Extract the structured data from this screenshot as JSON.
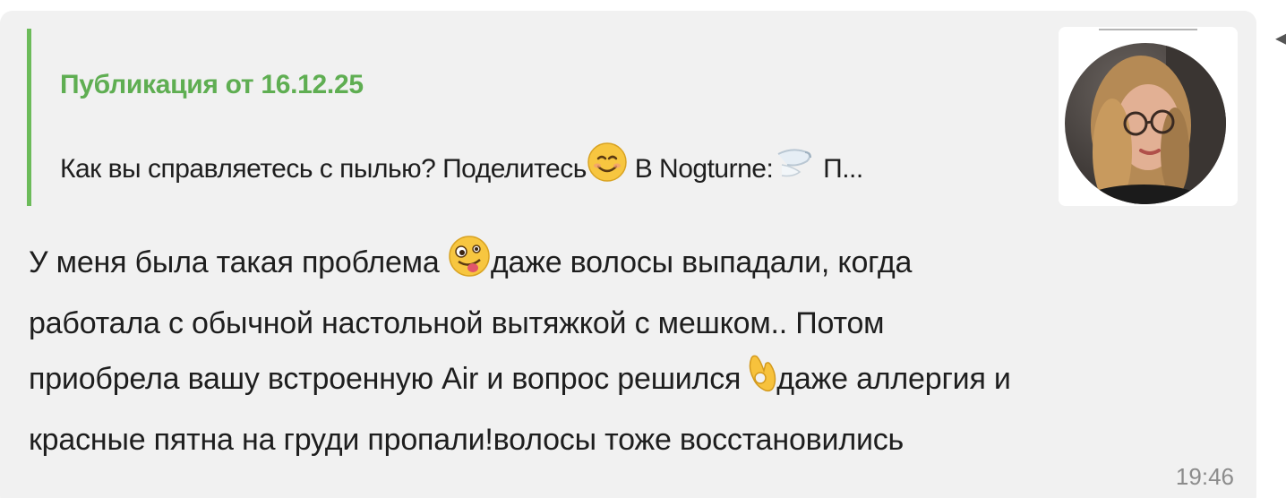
{
  "reply": {
    "title": "Публикация от 16.12.25",
    "snippet_part1": "Как вы справляетесь с пылью? Поделитесь",
    "snippet_part2": " В Nogturne:",
    "snippet_part3": " П..."
  },
  "message": {
    "line1_a": "У меня была такая проблема ",
    "line1_b": "даже волосы выпадали, когда",
    "line2": "работала с обычной настольной вытяжкой с мешком.. Потом",
    "line3_a": "приобрела вашу встроенную Air и вопрос решился",
    "line3_b": "даже аллергия и",
    "line4": "красные пятна на груди пропали!волосы тоже восстановились",
    "time": "19:46"
  },
  "icons": {
    "reply_emoji_1": "smiling-face-icon",
    "reply_emoji_2": "wind-icon",
    "message_emoji_1": "zany-face-icon",
    "message_emoji_2": "ok-hand-icon",
    "side": "chevron-left-icon"
  },
  "colors": {
    "accent": "#6cbb5a",
    "bubble": "#f1f1f1",
    "text": "#1e1e1e",
    "time": "#8c8c8c"
  }
}
